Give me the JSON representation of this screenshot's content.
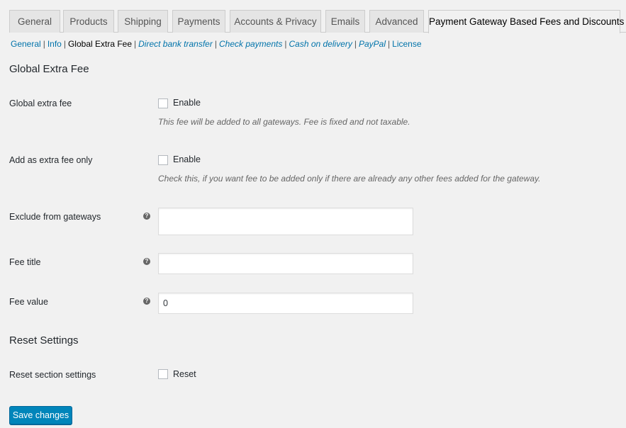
{
  "tabs": [
    {
      "label": "General",
      "active": false
    },
    {
      "label": "Products",
      "active": false
    },
    {
      "label": "Shipping",
      "active": false
    },
    {
      "label": "Payments",
      "active": false
    },
    {
      "label": "Accounts & Privacy",
      "active": false
    },
    {
      "label": "Emails",
      "active": false
    },
    {
      "label": "Advanced",
      "active": false
    },
    {
      "label": "Payment Gateway Based Fees and Discounts",
      "active": true
    }
  ],
  "subnav": {
    "items": [
      {
        "label": "General",
        "current": false,
        "italic": false
      },
      {
        "label": "Info",
        "current": false,
        "italic": false
      },
      {
        "label": "Global Extra Fee",
        "current": true,
        "italic": false
      },
      {
        "label": "Direct bank transfer",
        "current": false,
        "italic": true
      },
      {
        "label": "Check payments",
        "current": false,
        "italic": true
      },
      {
        "label": "Cash on delivery",
        "current": false,
        "italic": true
      },
      {
        "label": "PayPal",
        "current": false,
        "italic": true
      },
      {
        "label": "License",
        "current": false,
        "italic": false
      }
    ],
    "separator": "|"
  },
  "section_global": {
    "title": "Global Extra Fee",
    "global_extra_fee": {
      "label": "Global extra fee",
      "checkbox_label": "Enable",
      "checked": false,
      "description": "This fee will be added to all gateways. Fee is fixed and not taxable."
    },
    "extra_fee_only": {
      "label": "Add as extra fee only",
      "checkbox_label": "Enable",
      "checked": false,
      "description": "Check this, if you want fee to be added only if there are already any other fees added for the gateway."
    },
    "exclude_gateways": {
      "label": "Exclude from gateways",
      "value": "",
      "help_icon": "?"
    },
    "fee_title": {
      "label": "Fee title",
      "value": "",
      "help_icon": "?"
    },
    "fee_value": {
      "label": "Fee value",
      "value": "0",
      "help_icon": "?"
    }
  },
  "section_reset": {
    "title": "Reset Settings",
    "reset": {
      "label": "Reset section settings",
      "checkbox_label": "Reset",
      "checked": false
    }
  },
  "save_button": "Save changes",
  "colors": {
    "accent": "#0085ba",
    "link": "#0073aa",
    "background": "#f1f1f1"
  }
}
